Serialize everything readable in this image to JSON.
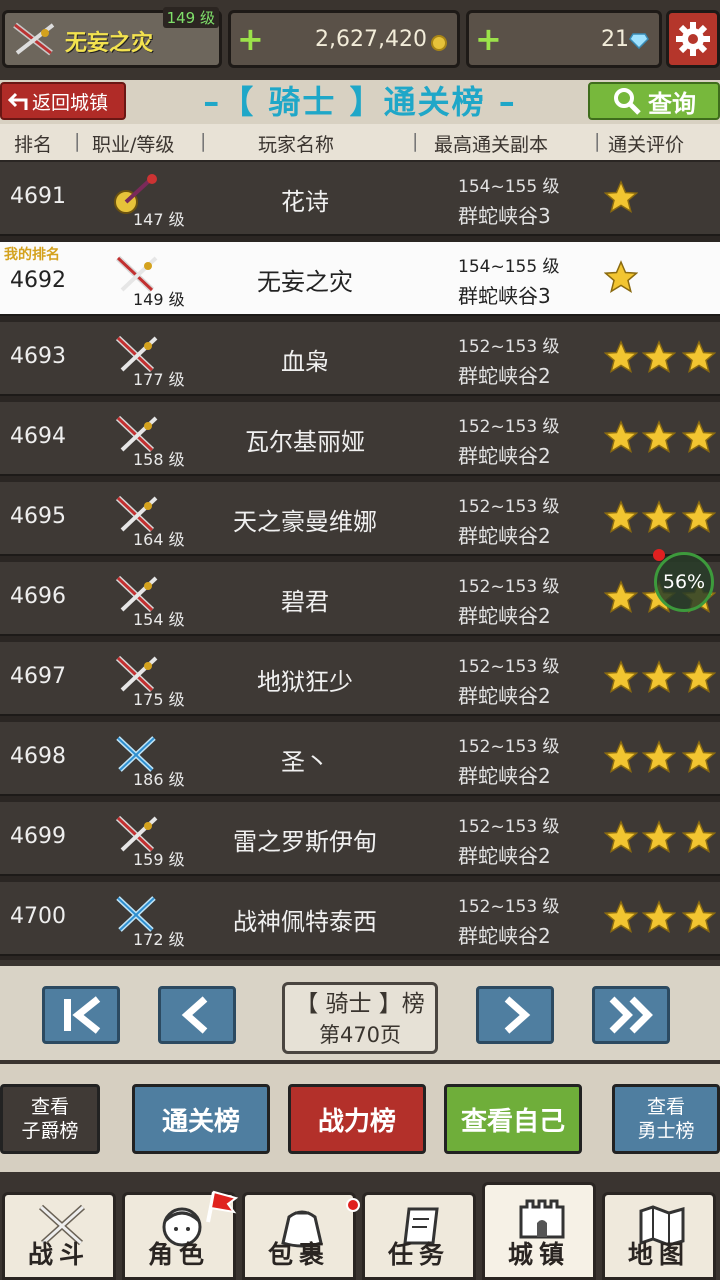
{
  "player": {
    "name": "无妄之灾",
    "level": "149 级"
  },
  "currency": {
    "gold": "2,627,420",
    "gems": "21"
  },
  "header": {
    "back_label": "返回城镇",
    "title": "–【 骑士 】通关榜 –",
    "search_label": "查询"
  },
  "columns": [
    "排名",
    "职业/等级",
    "玩家名称",
    "最高通关副本",
    "通关评价"
  ],
  "my_rank_tag": "我的排名",
  "rows": [
    {
      "rank": "4691",
      "class": "mage",
      "level": "147 级",
      "name": "花诗",
      "range": "154~155 级",
      "dungeon": "群蛇峡谷3",
      "stars": 1,
      "mine": false
    },
    {
      "rank": "4692",
      "class": "knight",
      "level": "149 级",
      "name": "无妄之灾",
      "range": "154~155 级",
      "dungeon": "群蛇峡谷3",
      "stars": 1,
      "mine": true
    },
    {
      "rank": "4693",
      "class": "knight",
      "level": "177 级",
      "name": "血枭",
      "range": "152~153 级",
      "dungeon": "群蛇峡谷2",
      "stars": 3,
      "mine": false
    },
    {
      "rank": "4694",
      "class": "knight",
      "level": "158 级",
      "name": "瓦尔基丽娅",
      "range": "152~153 级",
      "dungeon": "群蛇峡谷2",
      "stars": 3,
      "mine": false
    },
    {
      "rank": "4695",
      "class": "knight",
      "level": "164 级",
      "name": "天之豪曼维娜",
      "range": "152~153 级",
      "dungeon": "群蛇峡谷2",
      "stars": 3,
      "mine": false
    },
    {
      "rank": "4696",
      "class": "knight",
      "level": "154 级",
      "name": "碧君",
      "range": "152~153 级",
      "dungeon": "群蛇峡谷2",
      "stars": 3,
      "mine": false
    },
    {
      "rank": "4697",
      "class": "knight",
      "level": "175 级",
      "name": "地狱狂少",
      "range": "152~153 级",
      "dungeon": "群蛇峡谷2",
      "stars": 3,
      "mine": false
    },
    {
      "rank": "4698",
      "class": "blade",
      "level": "186 级",
      "name": "圣丶",
      "range": "152~153 级",
      "dungeon": "群蛇峡谷2",
      "stars": 3,
      "mine": false
    },
    {
      "rank": "4699",
      "class": "knight",
      "level": "159 级",
      "name": "雷之罗斯伊甸",
      "range": "152~153 级",
      "dungeon": "群蛇峡谷2",
      "stars": 3,
      "mine": false
    },
    {
      "rank": "4700",
      "class": "blade",
      "level": "172 级",
      "name": "战神佩特泰西",
      "range": "152~153 级",
      "dungeon": "群蛇峡谷2",
      "stars": 3,
      "mine": false
    }
  ],
  "progress_badge": "56%",
  "pager": {
    "board": "【 骑士 】榜",
    "page": "第470页"
  },
  "tabs": {
    "baron_l1": "查看",
    "baron_l2": "子爵榜",
    "clear": "通关榜",
    "power": "战力榜",
    "self": "查看自己",
    "hero_l1": "查看",
    "hero_l2": "勇士榜"
  },
  "nav": [
    "战斗",
    "角色",
    "包裹",
    "任务",
    "城镇",
    "地图"
  ],
  "colors": {
    "star": "#f2c531",
    "title": "#1fa7c8",
    "back": "#b02b27",
    "search": "#77b83c",
    "pager": "#4f7ea0"
  }
}
